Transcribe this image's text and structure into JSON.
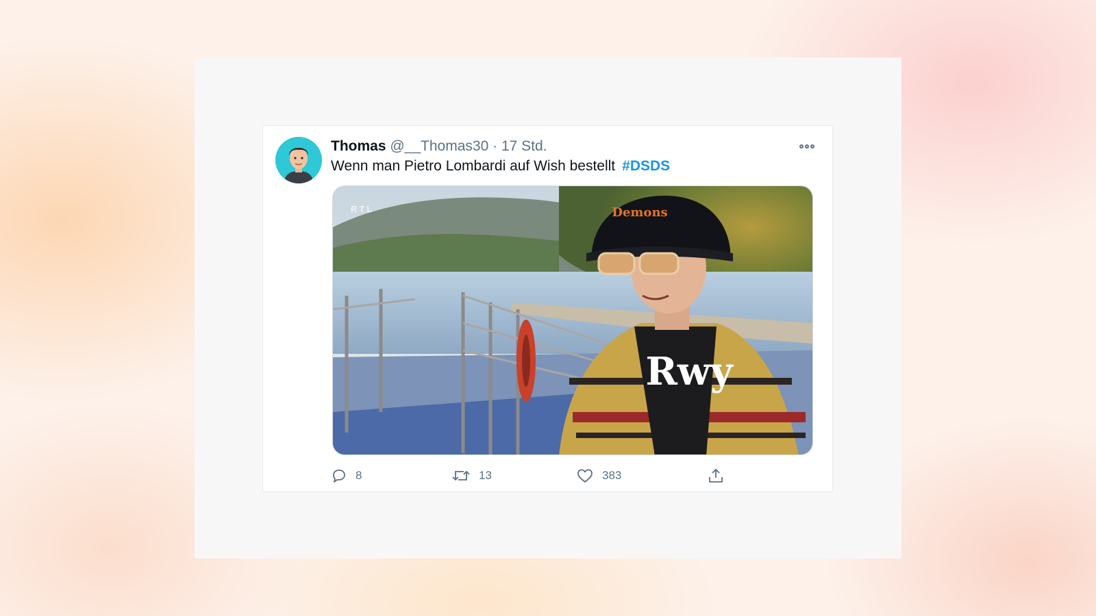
{
  "tweet": {
    "display_name": "Thomas",
    "handle": "@__Thomas30",
    "separator": "·",
    "time": "17 Std.",
    "text": "Wenn man Pietro Lombardi auf Wish bestellt",
    "hashtag": "#DSDS",
    "media": {
      "watermark": "RTL",
      "cap_logo": "Demons",
      "shirt_text": "Rwy"
    },
    "actions": {
      "reply_count": "8",
      "retweet_count": "13",
      "like_count": "383"
    }
  },
  "colors": {
    "link": "#1b95e0",
    "secondary_text": "#5b7083",
    "avatar_bg": "#2ec8d6"
  },
  "icons": [
    "more-options-icon",
    "reply-icon",
    "retweet-icon",
    "like-icon",
    "share-icon"
  ]
}
